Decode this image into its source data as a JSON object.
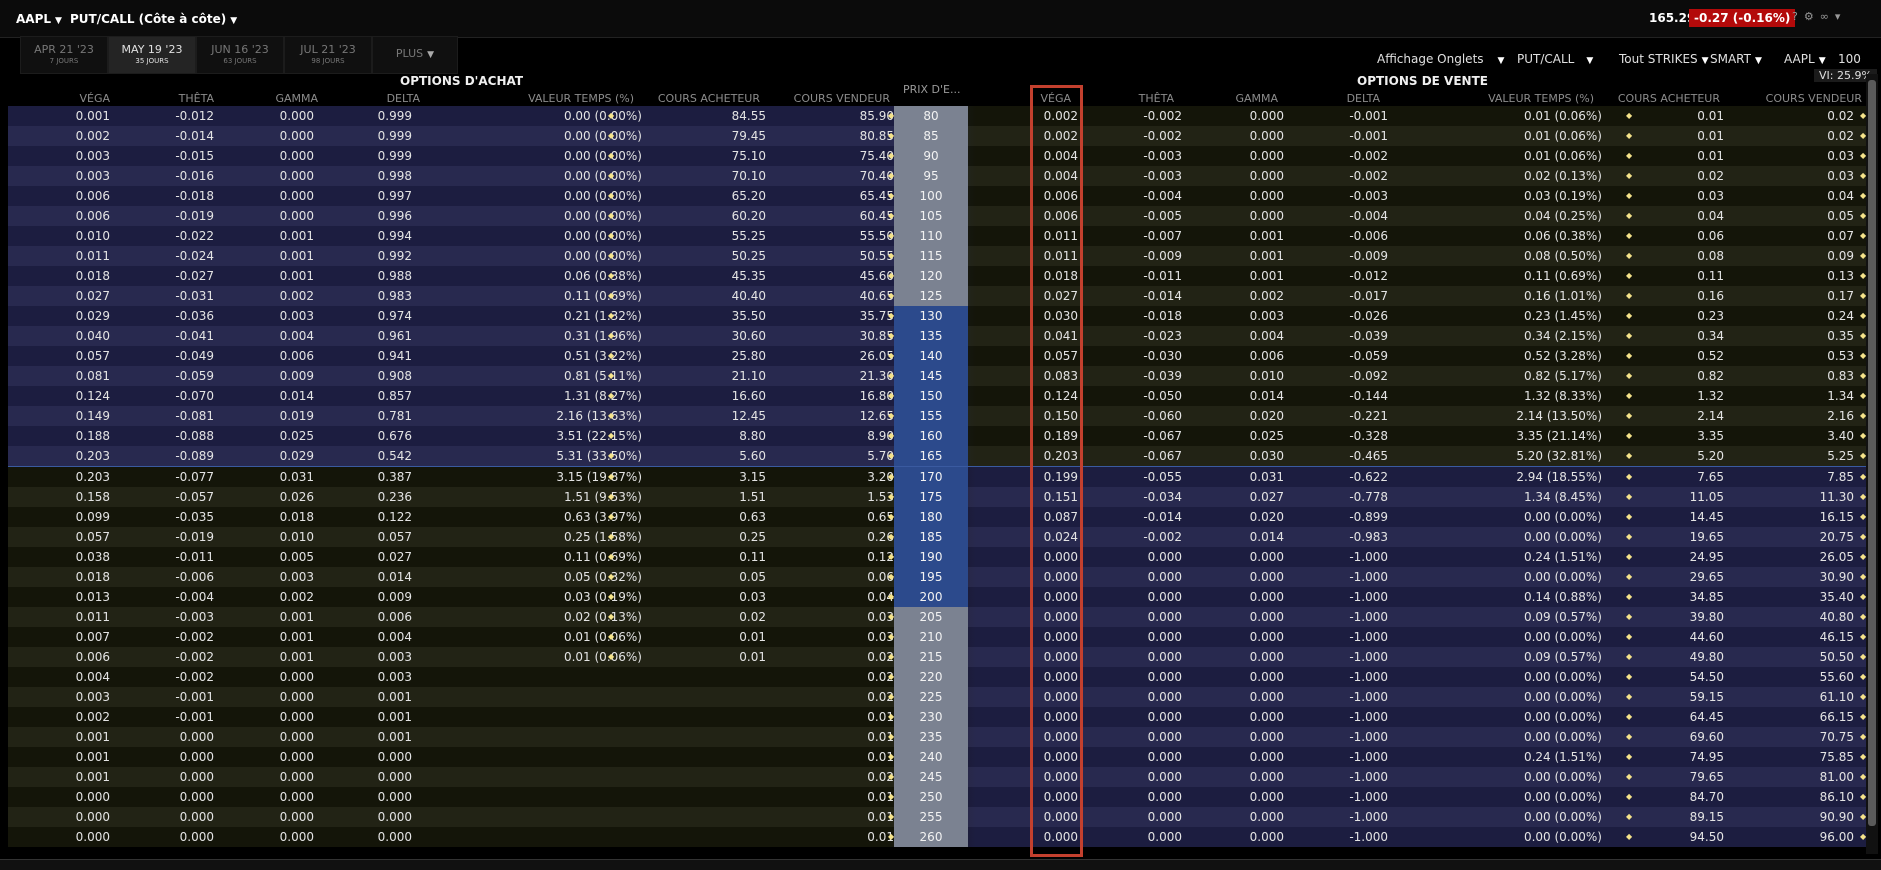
{
  "header": {
    "symbol": "AAPL",
    "mode": "PUT/CALL (Côte à côte)",
    "last_price": "165.29",
    "change": "-0.27 (-0.16%)"
  },
  "expiry_tabs": [
    {
      "label": "APR 21 '23",
      "days": "7 JOURS"
    },
    {
      "label": "MAY 19 '23",
      "days": "35 JOURS"
    },
    {
      "label": "JUN 16 '23",
      "days": "63 JOURS"
    },
    {
      "label": "JUL 21 '23",
      "days": "98 JOURS"
    },
    {
      "label": "PLUS",
      "days": ""
    }
  ],
  "toolbar": {
    "display": "Affichage Onglets",
    "mode": "PUT/CALL",
    "strikes": "Tout STRIKES",
    "exchange": "SMART",
    "underlying": "AAPL",
    "multiplier": "100",
    "vi": "VI: 25.9%"
  },
  "sections": {
    "calls": "OPTIONS D'ACHAT",
    "puts": "OPTIONS DE VENTE",
    "strike": "PRIX D'E..."
  },
  "columns": [
    "VÉGA",
    "THÊTA",
    "GAMMA",
    "DELTA",
    "VALEUR TEMPS (%)",
    "COURS ACHETEUR",
    "COURS VENDEUR"
  ],
  "colors": {
    "highlight": "#c3402e",
    "change_bg": "#b30a0a",
    "strike_itm": "#2c4a8c",
    "strike_otm": "#7b8291"
  },
  "rows": [
    {
      "strike": "80",
      "call": [
        "0.001",
        "-0.012",
        "0.000",
        "0.999",
        "0.00 (0.00%)",
        "84.55",
        "85.90"
      ],
      "put": [
        "0.002",
        "-0.002",
        "0.000",
        "-0.001",
        "0.01 (0.06%)",
        "0.01",
        "0.02"
      ]
    },
    {
      "strike": "85",
      "call": [
        "0.002",
        "-0.014",
        "0.000",
        "0.999",
        "0.00 (0.00%)",
        "79.45",
        "80.85"
      ],
      "put": [
        "0.002",
        "-0.002",
        "0.000",
        "-0.001",
        "0.01 (0.06%)",
        "0.01",
        "0.02"
      ]
    },
    {
      "strike": "90",
      "call": [
        "0.003",
        "-0.015",
        "0.000",
        "0.999",
        "0.00 (0.00%)",
        "75.10",
        "75.40"
      ],
      "put": [
        "0.004",
        "-0.003",
        "0.000",
        "-0.002",
        "0.01 (0.06%)",
        "0.01",
        "0.03"
      ]
    },
    {
      "strike": "95",
      "call": [
        "0.003",
        "-0.016",
        "0.000",
        "0.998",
        "0.00 (0.00%)",
        "70.10",
        "70.40"
      ],
      "put": [
        "0.004",
        "-0.003",
        "0.000",
        "-0.002",
        "0.02 (0.13%)",
        "0.02",
        "0.03"
      ]
    },
    {
      "strike": "100",
      "call": [
        "0.006",
        "-0.018",
        "0.000",
        "0.997",
        "0.00 (0.00%)",
        "65.20",
        "65.45"
      ],
      "put": [
        "0.006",
        "-0.004",
        "0.000",
        "-0.003",
        "0.03 (0.19%)",
        "0.03",
        "0.04"
      ]
    },
    {
      "strike": "105",
      "call": [
        "0.006",
        "-0.019",
        "0.000",
        "0.996",
        "0.00 (0.00%)",
        "60.20",
        "60.45"
      ],
      "put": [
        "0.006",
        "-0.005",
        "0.000",
        "-0.004",
        "0.04 (0.25%)",
        "0.04",
        "0.05"
      ]
    },
    {
      "strike": "110",
      "call": [
        "0.010",
        "-0.022",
        "0.001",
        "0.994",
        "0.00 (0.00%)",
        "55.25",
        "55.50"
      ],
      "put": [
        "0.011",
        "-0.007",
        "0.001",
        "-0.006",
        "0.06 (0.38%)",
        "0.06",
        "0.07"
      ]
    },
    {
      "strike": "115",
      "call": [
        "0.011",
        "-0.024",
        "0.001",
        "0.992",
        "0.00 (0.00%)",
        "50.25",
        "50.55"
      ],
      "put": [
        "0.011",
        "-0.009",
        "0.001",
        "-0.009",
        "0.08 (0.50%)",
        "0.08",
        "0.09"
      ]
    },
    {
      "strike": "120",
      "call": [
        "0.018",
        "-0.027",
        "0.001",
        "0.988",
        "0.06 (0.38%)",
        "45.35",
        "45.60"
      ],
      "put": [
        "0.018",
        "-0.011",
        "0.001",
        "-0.012",
        "0.11 (0.69%)",
        "0.11",
        "0.13"
      ]
    },
    {
      "strike": "125",
      "call": [
        "0.027",
        "-0.031",
        "0.002",
        "0.983",
        "0.11 (0.69%)",
        "40.40",
        "40.65"
      ],
      "put": [
        "0.027",
        "-0.014",
        "0.002",
        "-0.017",
        "0.16 (1.01%)",
        "0.16",
        "0.17"
      ]
    },
    {
      "strike": "130",
      "call": [
        "0.029",
        "-0.036",
        "0.003",
        "0.974",
        "0.21 (1.32%)",
        "35.50",
        "35.75"
      ],
      "put": [
        "0.030",
        "-0.018",
        "0.003",
        "-0.026",
        "0.23 (1.45%)",
        "0.23",
        "0.24"
      ]
    },
    {
      "strike": "135",
      "call": [
        "0.040",
        "-0.041",
        "0.004",
        "0.961",
        "0.31 (1.96%)",
        "30.60",
        "30.85"
      ],
      "put": [
        "0.041",
        "-0.023",
        "0.004",
        "-0.039",
        "0.34 (2.15%)",
        "0.34",
        "0.35"
      ]
    },
    {
      "strike": "140",
      "call": [
        "0.057",
        "-0.049",
        "0.006",
        "0.941",
        "0.51 (3.22%)",
        "25.80",
        "26.05"
      ],
      "put": [
        "0.057",
        "-0.030",
        "0.006",
        "-0.059",
        "0.52 (3.28%)",
        "0.52",
        "0.53"
      ]
    },
    {
      "strike": "145",
      "call": [
        "0.081",
        "-0.059",
        "0.009",
        "0.908",
        "0.81 (5.11%)",
        "21.10",
        "21.30"
      ],
      "put": [
        "0.083",
        "-0.039",
        "0.010",
        "-0.092",
        "0.82 (5.17%)",
        "0.82",
        "0.83"
      ]
    },
    {
      "strike": "150",
      "call": [
        "0.124",
        "-0.070",
        "0.014",
        "0.857",
        "1.31 (8.27%)",
        "16.60",
        "16.80"
      ],
      "put": [
        "0.124",
        "-0.050",
        "0.014",
        "-0.144",
        "1.32 (8.33%)",
        "1.32",
        "1.34"
      ]
    },
    {
      "strike": "155",
      "call": [
        "0.149",
        "-0.081",
        "0.019",
        "0.781",
        "2.16 (13.63%)",
        "12.45",
        "12.65"
      ],
      "put": [
        "0.150",
        "-0.060",
        "0.020",
        "-0.221",
        "2.14 (13.50%)",
        "2.14",
        "2.16"
      ]
    },
    {
      "strike": "160",
      "call": [
        "0.188",
        "-0.088",
        "0.025",
        "0.676",
        "3.51 (22.15%)",
        "8.80",
        "8.90"
      ],
      "put": [
        "0.189",
        "-0.067",
        "0.025",
        "-0.328",
        "3.35 (21.14%)",
        "3.35",
        "3.40"
      ]
    },
    {
      "strike": "165",
      "call": [
        "0.203",
        "-0.089",
        "0.029",
        "0.542",
        "5.31 (33.50%)",
        "5.60",
        "5.70"
      ],
      "put": [
        "0.203",
        "-0.067",
        "0.030",
        "-0.465",
        "5.20 (32.81%)",
        "5.20",
        "5.25"
      ]
    },
    {
      "strike": "170",
      "call": [
        "0.203",
        "-0.077",
        "0.031",
        "0.387",
        "3.15 (19.87%)",
        "3.15",
        "3.20"
      ],
      "put": [
        "0.199",
        "-0.055",
        "0.031",
        "-0.622",
        "2.94 (18.55%)",
        "7.65",
        "7.85"
      ]
    },
    {
      "strike": "175",
      "call": [
        "0.158",
        "-0.057",
        "0.026",
        "0.236",
        "1.51 (9.53%)",
        "1.51",
        "1.53"
      ],
      "put": [
        "0.151",
        "-0.034",
        "0.027",
        "-0.778",
        "1.34 (8.45%)",
        "11.05",
        "11.30"
      ]
    },
    {
      "strike": "180",
      "call": [
        "0.099",
        "-0.035",
        "0.018",
        "0.122",
        "0.63 (3.97%)",
        "0.63",
        "0.65"
      ],
      "put": [
        "0.087",
        "-0.014",
        "0.020",
        "-0.899",
        "0.00 (0.00%)",
        "14.45",
        "16.15"
      ]
    },
    {
      "strike": "185",
      "call": [
        "0.057",
        "-0.019",
        "0.010",
        "0.057",
        "0.25 (1.58%)",
        "0.25",
        "0.26"
      ],
      "put": [
        "0.024",
        "-0.002",
        "0.014",
        "-0.983",
        "0.00 (0.00%)",
        "19.65",
        "20.75"
      ]
    },
    {
      "strike": "190",
      "call": [
        "0.038",
        "-0.011",
        "0.005",
        "0.027",
        "0.11 (0.69%)",
        "0.11",
        "0.12"
      ],
      "put": [
        "0.000",
        "0.000",
        "0.000",
        "-1.000",
        "0.24 (1.51%)",
        "24.95",
        "26.05"
      ]
    },
    {
      "strike": "195",
      "call": [
        "0.018",
        "-0.006",
        "0.003",
        "0.014",
        "0.05 (0.32%)",
        "0.05",
        "0.06"
      ],
      "put": [
        "0.000",
        "0.000",
        "0.000",
        "-1.000",
        "0.00 (0.00%)",
        "29.65",
        "30.90"
      ]
    },
    {
      "strike": "200",
      "call": [
        "0.013",
        "-0.004",
        "0.002",
        "0.009",
        "0.03 (0.19%)",
        "0.03",
        "0.04"
      ],
      "put": [
        "0.000",
        "0.000",
        "0.000",
        "-1.000",
        "0.14 (0.88%)",
        "34.85",
        "35.40"
      ]
    },
    {
      "strike": "205",
      "call": [
        "0.011",
        "-0.003",
        "0.001",
        "0.006",
        "0.02 (0.13%)",
        "0.02",
        "0.03"
      ],
      "put": [
        "0.000",
        "0.000",
        "0.000",
        "-1.000",
        "0.09 (0.57%)",
        "39.80",
        "40.80"
      ]
    },
    {
      "strike": "210",
      "call": [
        "0.007",
        "-0.002",
        "0.001",
        "0.004",
        "0.01 (0.06%)",
        "0.01",
        "0.03"
      ],
      "put": [
        "0.000",
        "0.000",
        "0.000",
        "-1.000",
        "0.00 (0.00%)",
        "44.60",
        "46.15"
      ]
    },
    {
      "strike": "215",
      "call": [
        "0.006",
        "-0.002",
        "0.001",
        "0.003",
        "0.01 (0.06%)",
        "0.01",
        "0.02"
      ],
      "put": [
        "0.000",
        "0.000",
        "0.000",
        "-1.000",
        "0.09 (0.57%)",
        "49.80",
        "50.50"
      ]
    },
    {
      "strike": "220",
      "call": [
        "0.004",
        "-0.002",
        "0.000",
        "0.003",
        "",
        "",
        "0.02"
      ],
      "put": [
        "0.000",
        "0.000",
        "0.000",
        "-1.000",
        "0.00 (0.00%)",
        "54.50",
        "55.60"
      ]
    },
    {
      "strike": "225",
      "call": [
        "0.003",
        "-0.001",
        "0.000",
        "0.001",
        "",
        "",
        "0.02"
      ],
      "put": [
        "0.000",
        "0.000",
        "0.000",
        "-1.000",
        "0.00 (0.00%)",
        "59.15",
        "61.10"
      ]
    },
    {
      "strike": "230",
      "call": [
        "0.002",
        "-0.001",
        "0.000",
        "0.001",
        "",
        "",
        "0.01"
      ],
      "put": [
        "0.000",
        "0.000",
        "0.000",
        "-1.000",
        "0.00 (0.00%)",
        "64.45",
        "66.15"
      ]
    },
    {
      "strike": "235",
      "call": [
        "0.001",
        "0.000",
        "0.000",
        "0.001",
        "",
        "",
        "0.01"
      ],
      "put": [
        "0.000",
        "0.000",
        "0.000",
        "-1.000",
        "0.00 (0.00%)",
        "69.60",
        "70.75"
      ]
    },
    {
      "strike": "240",
      "call": [
        "0.001",
        "0.000",
        "0.000",
        "0.000",
        "",
        "",
        "0.01"
      ],
      "put": [
        "0.000",
        "0.000",
        "0.000",
        "-1.000",
        "0.24 (1.51%)",
        "74.95",
        "75.85"
      ]
    },
    {
      "strike": "245",
      "call": [
        "0.001",
        "0.000",
        "0.000",
        "0.000",
        "",
        "",
        "0.02"
      ],
      "put": [
        "0.000",
        "0.000",
        "0.000",
        "-1.000",
        "0.00 (0.00%)",
        "79.65",
        "81.00"
      ]
    },
    {
      "strike": "250",
      "call": [
        "0.000",
        "0.000",
        "0.000",
        "0.000",
        "",
        "",
        "0.01"
      ],
      "put": [
        "0.000",
        "0.000",
        "0.000",
        "-1.000",
        "0.00 (0.00%)",
        "84.70",
        "86.10"
      ]
    },
    {
      "strike": "255",
      "call": [
        "0.000",
        "0.000",
        "0.000",
        "0.000",
        "",
        "",
        "0.01"
      ],
      "put": [
        "0.000",
        "0.000",
        "0.000",
        "-1.000",
        "0.00 (0.00%)",
        "89.15",
        "90.90"
      ]
    },
    {
      "strike": "260",
      "call": [
        "0.000",
        "0.000",
        "0.000",
        "0.000",
        "",
        "",
        "0.01"
      ],
      "put": [
        "0.000",
        "0.000",
        "0.000",
        "-1.000",
        "0.00 (0.00%)",
        "94.50",
        "96.00"
      ]
    }
  ]
}
